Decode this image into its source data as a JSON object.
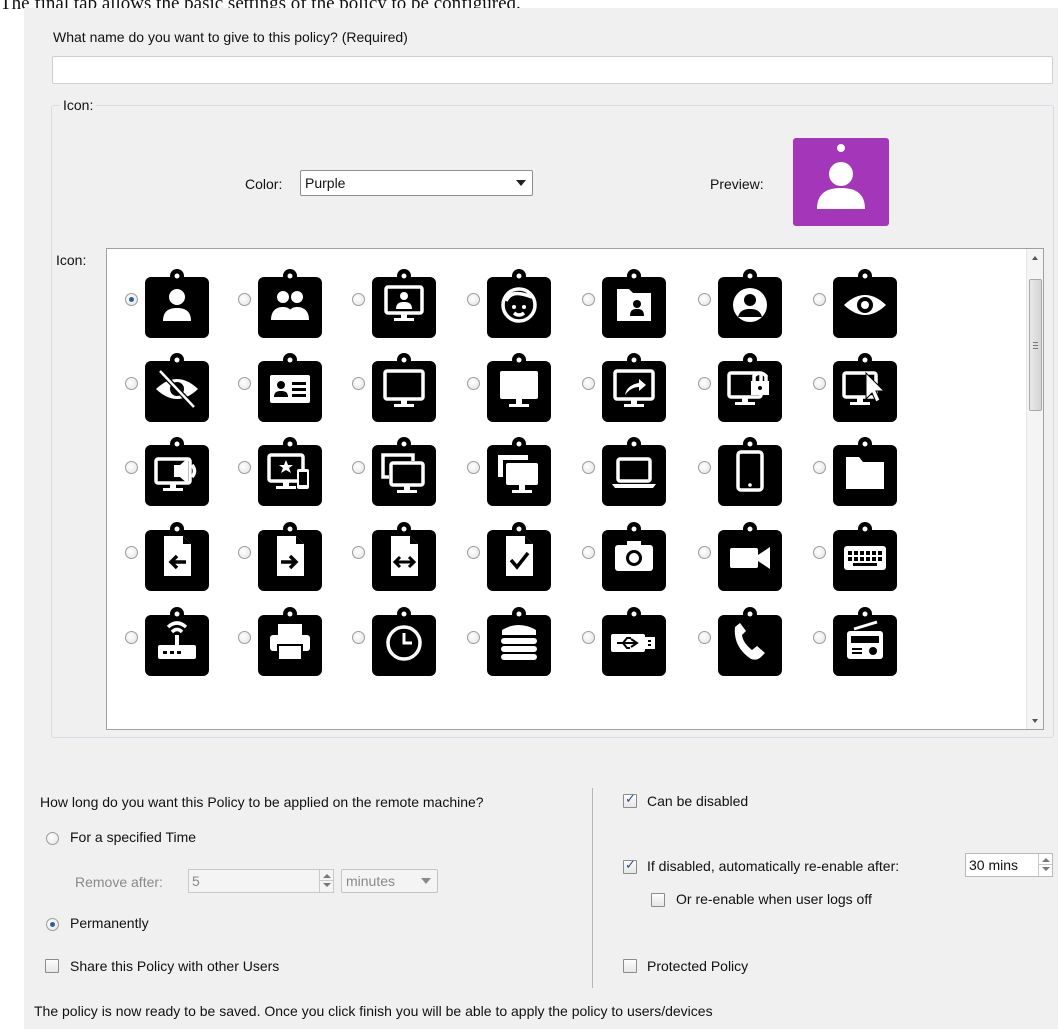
{
  "caption": "The final tab allows the basic settings of the policy to be configured.",
  "name_section": {
    "question": "What name do you want to give to this policy? (Required)",
    "value": ""
  },
  "icon_group": {
    "legend": "Icon:",
    "color_label": "Color:",
    "color_value": "Purple",
    "preview_label": "Preview:",
    "preview_color": "#a436b9",
    "preview_icon": "person-icon",
    "list_label": "Icon:",
    "selected_index": 0,
    "icons": [
      "person-icon",
      "two-people-icon",
      "monitor-person-icon",
      "face-icon",
      "folder-person-icon",
      "person-circle-icon",
      "eye-icon",
      "eye-off-icon",
      "id-card-icon",
      "monitor-icon",
      "monitor-filled-icon",
      "monitor-share-icon",
      "monitor-lock-icon",
      "monitor-cursor-icon",
      "monitor-speaker-icon",
      "monitor-phone-icon",
      "monitors-stack-icon",
      "monitors-stack-filled-icon",
      "laptop-icon",
      "tablet-icon",
      "folder-icon",
      "file-arrow-left-icon",
      "file-arrow-right-icon",
      "file-arrows-icon",
      "file-check-icon",
      "camera-icon",
      "video-camera-icon",
      "keyboard-icon",
      "wifi-router-icon",
      "printer-icon",
      "clock-icon",
      "server-stack-icon",
      "usb-drive-icon",
      "phone-icon",
      "radio-icon"
    ]
  },
  "duration": {
    "question": "How long do you want this Policy to be applied on the remote machine?",
    "option_specified": "For a specified Time",
    "remove_after_label": "Remove after:",
    "remove_after_value": "5",
    "unit_value": "minutes",
    "option_permanent": "Permanently",
    "selected": "permanent",
    "share_label": "Share this Policy with other Users",
    "share_checked": false
  },
  "options": {
    "can_be_disabled_label": "Can be disabled",
    "can_be_disabled_checked": true,
    "reenable_label": "If disabled, automatically re-enable after:",
    "reenable_checked": true,
    "reenable_value": "30 mins",
    "logoff_label": "Or re-enable when user logs off",
    "logoff_checked": false,
    "protected_label": "Protected Policy",
    "protected_checked": false
  },
  "footer_text": "The policy is now ready to be saved. Once you click finish you will be able to apply the policy to users/devices"
}
